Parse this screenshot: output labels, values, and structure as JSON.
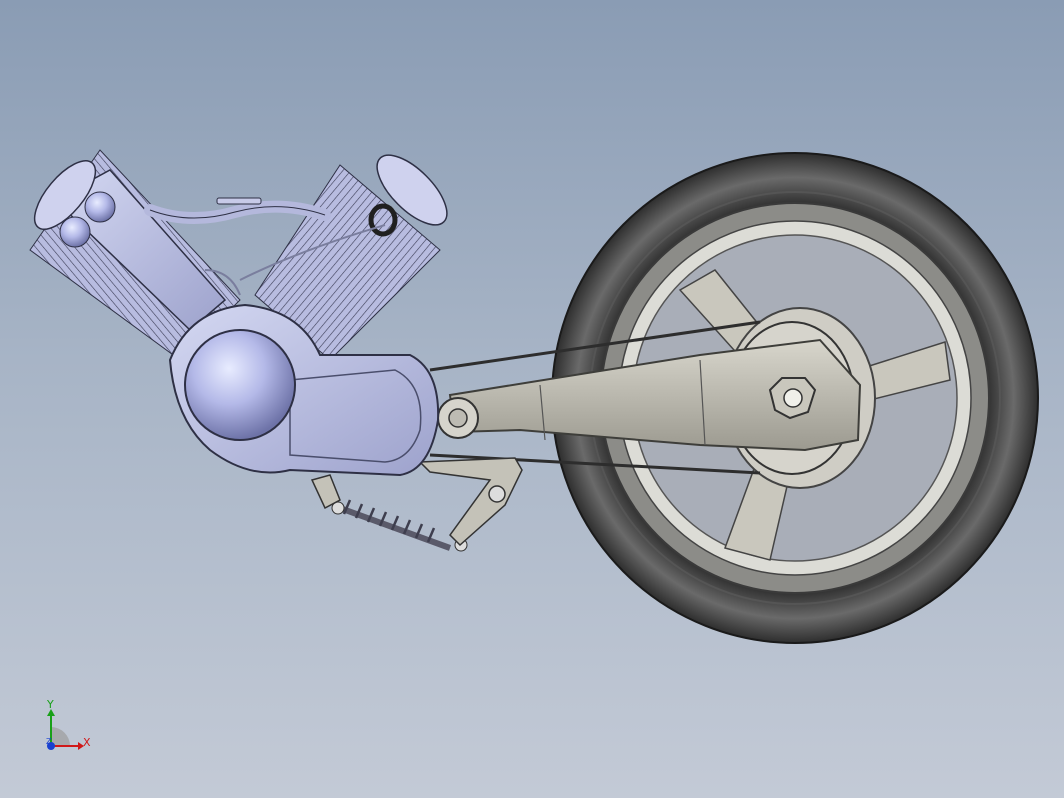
{
  "viewport": {
    "background_top": "#8a9cb4",
    "background_bottom": "#c3cad6",
    "model_parts": [
      "v-twin-engine",
      "swingarm",
      "rear-wheel",
      "drive-chain",
      "rear-shock",
      "linkage"
    ]
  },
  "triad": {
    "x_label": "X",
    "y_label": "Y",
    "z_label": "Z",
    "x_color": "#d01818",
    "y_color": "#18a018",
    "z_color": "#1840d0"
  }
}
